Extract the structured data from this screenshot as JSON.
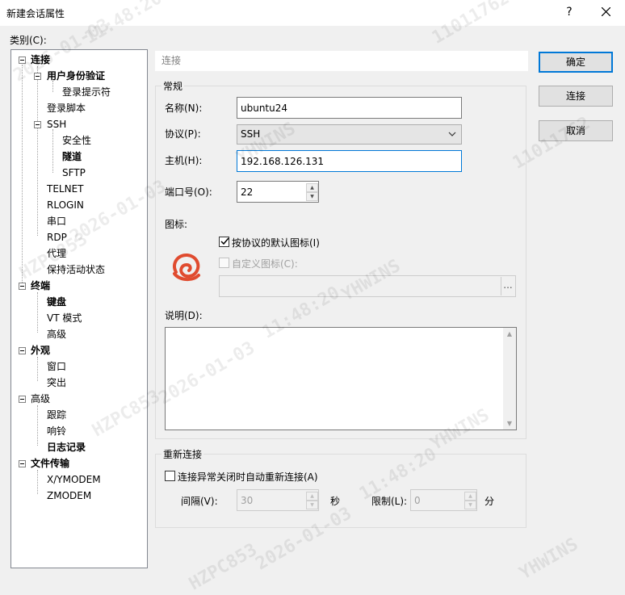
{
  "window": {
    "title": "新建会话属性",
    "help_glyph": "?"
  },
  "category_label": "类别(C):",
  "tree": {
    "items": [
      {
        "label": "连接",
        "bold": true
      },
      {
        "label": "用户身份验证",
        "bold": true
      },
      {
        "label": "登录提示符",
        "bold": false
      },
      {
        "label": "登录脚本",
        "bold": false
      },
      {
        "label": "SSH",
        "bold": false
      },
      {
        "label": "安全性",
        "bold": false
      },
      {
        "label": "隧道",
        "bold": true
      },
      {
        "label": "SFTP",
        "bold": false
      },
      {
        "label": "TELNET",
        "bold": false
      },
      {
        "label": "RLOGIN",
        "bold": false
      },
      {
        "label": "串口",
        "bold": false
      },
      {
        "label": "RDP",
        "bold": false
      },
      {
        "label": "代理",
        "bold": false
      },
      {
        "label": "保持活动状态",
        "bold": false
      },
      {
        "label": "终端",
        "bold": true
      },
      {
        "label": "键盘",
        "bold": true
      },
      {
        "label": "VT 模式",
        "bold": false
      },
      {
        "label": "高级",
        "bold": false
      },
      {
        "label": "外观",
        "bold": true
      },
      {
        "label": "窗口",
        "bold": false
      },
      {
        "label": "突出",
        "bold": false
      },
      {
        "label": "高级",
        "bold": false
      },
      {
        "label": "跟踪",
        "bold": false
      },
      {
        "label": "响铃",
        "bold": false
      },
      {
        "label": "日志记录",
        "bold": true
      },
      {
        "label": "文件传输",
        "bold": true
      },
      {
        "label": "X/YMODEM",
        "bold": false
      },
      {
        "label": "ZMODEM",
        "bold": false
      }
    ]
  },
  "section_header": "连接",
  "general": {
    "title": "常规",
    "name_label": "名称(N):",
    "name_value": "ubuntu24",
    "protocol_label": "协议(P):",
    "protocol_value": "SSH",
    "host_label": "主机(H):",
    "host_value": "192.168.126.131",
    "port_label": "端口号(O):",
    "port_value": "22",
    "icon_label": "图标:",
    "default_icon_label": "按协议的默认图标(I)",
    "default_icon_checked": true,
    "custom_icon_label": "自定义图标(C):",
    "custom_icon_checked": false,
    "browse_label": "...",
    "description_label": "说明(D):",
    "description_value": ""
  },
  "reconnect": {
    "title": "重新连接",
    "auto_reconnect_label": "连接异常关闭时自动重新连接(A)",
    "auto_reconnect_checked": false,
    "interval_label": "间隔(V):",
    "interval_value": "30",
    "seconds_unit": "秒",
    "limit_label": "限制(L):",
    "limit_value": "0",
    "minutes_unit": "分"
  },
  "buttons": {
    "ok": "确定",
    "connect": "连接",
    "cancel": "取消"
  },
  "watermark": {
    "time": "11:48:20",
    "date": "2026-01-03",
    "user1": "HZPC853",
    "user2": "YHWINS",
    "id": "11011762"
  },
  "colors": {
    "accent": "#0078d7",
    "icon_red": "#e04b2f"
  }
}
